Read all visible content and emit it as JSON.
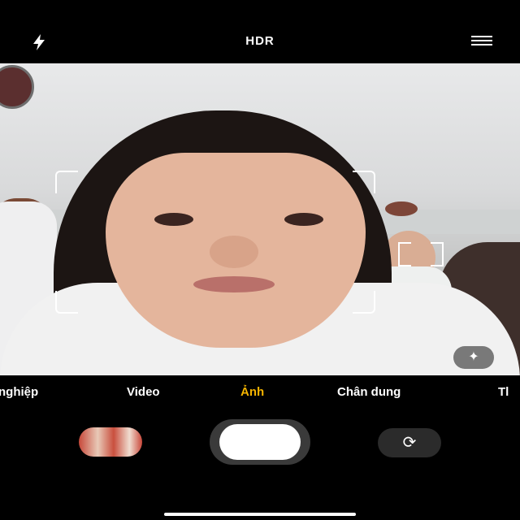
{
  "header": {
    "flash_icon": "lightning-bolt-icon",
    "hdr_label": "HDR",
    "menu_icon": "hamburger-menu-icon"
  },
  "viewfinder": {
    "scene_icon": "sparkle-icon"
  },
  "modes": [
    {
      "label": "nghiệp",
      "active": false
    },
    {
      "label": "Video",
      "active": false
    },
    {
      "label": "Ảnh",
      "active": true
    },
    {
      "label": "Chân dung",
      "active": false
    },
    {
      "label": "Tl",
      "active": false
    }
  ],
  "controls": {
    "gallery_icon": "gallery-thumbnail",
    "shutter_icon": "shutter-button",
    "switch_icon": "camera-switch-icon",
    "switch_glyph": "⟳"
  },
  "colors": {
    "accent": "#f5b400",
    "background": "#000000"
  }
}
